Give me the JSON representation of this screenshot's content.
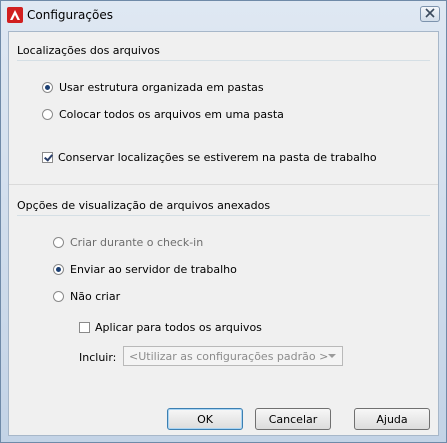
{
  "window": {
    "title": "Configurações"
  },
  "locations": {
    "heading": "Localizações dos arquivos",
    "option_structured": "Usar estrutura organizada em pastas",
    "option_single": "Colocar todos os arquivos em uma pasta",
    "keep_locations": "Conservar localizações se estiverem na pasta de trabalho",
    "selected": "option_structured",
    "keep_locations_checked": true
  },
  "attachments": {
    "heading": "Opções de visualização de arquivos anexados",
    "option_checkin": "Criar durante o check-in",
    "option_server": "Enviar ao servidor de trabalho",
    "option_none": "Não criar",
    "apply_all": "Aplicar para todos os arquivos",
    "include_label": "Incluir:",
    "include_value": "<Utilizar as configurações padrão >",
    "selected": "option_server",
    "apply_all_checked": false
  },
  "buttons": {
    "ok": "OK",
    "cancel": "Cancelar",
    "help": "Ajuda"
  },
  "icons": {
    "app": "autocad-logo-icon",
    "close": "close-icon"
  },
  "colors": {
    "accent": "#c3d3e6",
    "logo": "#d11f1f"
  }
}
